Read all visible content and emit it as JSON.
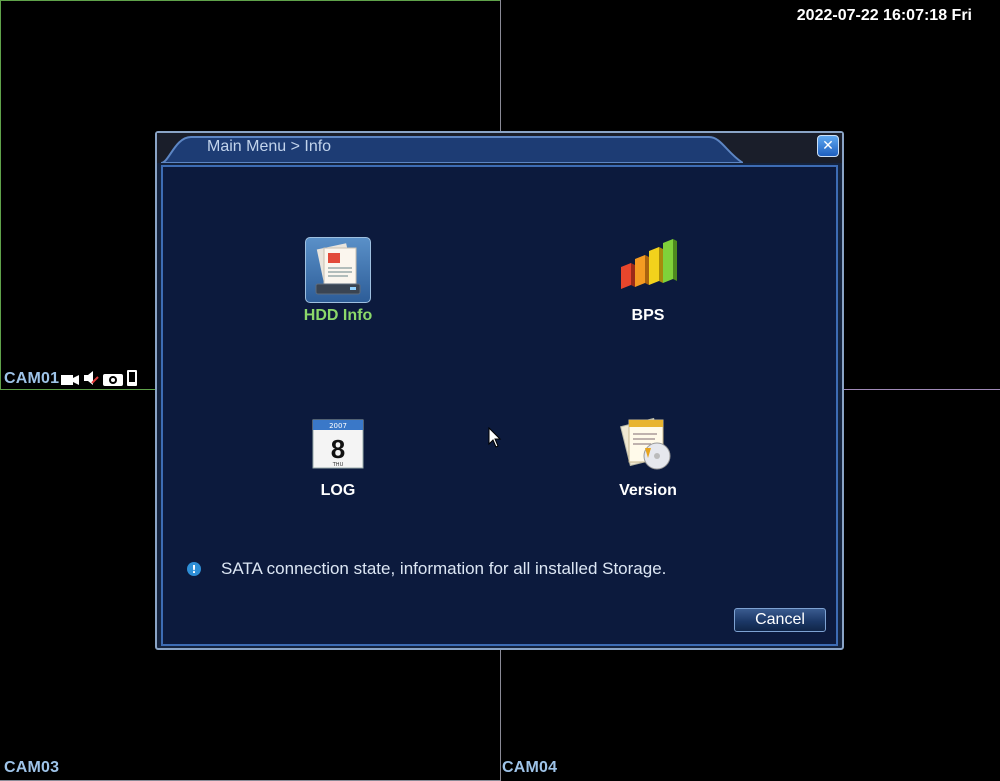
{
  "overlay": {
    "datetime": "2022-07-22 16:07:18 Fri",
    "cameras": {
      "cam01": "CAM01",
      "cam03": "CAM03",
      "cam04": "CAM04"
    },
    "cam01_status_icons": [
      "record-icon",
      "mute-icon",
      "snapshot-icon",
      "mobile-icon"
    ]
  },
  "dialog": {
    "title": "Main Menu > Info",
    "close_label": "✕",
    "items": [
      {
        "label": "HDD Info",
        "icon": "hdd-info-icon"
      },
      {
        "label": "BPS",
        "icon": "bps-chart-icon"
      },
      {
        "label": "LOG",
        "icon": "calendar-log-icon"
      },
      {
        "label": "Version",
        "icon": "version-document-icon"
      }
    ],
    "log_icon_date": {
      "year": "2007",
      "day": "8",
      "weekday": "THU"
    },
    "info_text": "SATA connection state, information for all installed Storage.",
    "cancel_label": "Cancel"
  },
  "colors": {
    "accent_selected": "#8bd86a",
    "dialog_bg": "#0c1a3d",
    "label_blue": "#9ec3e8"
  }
}
